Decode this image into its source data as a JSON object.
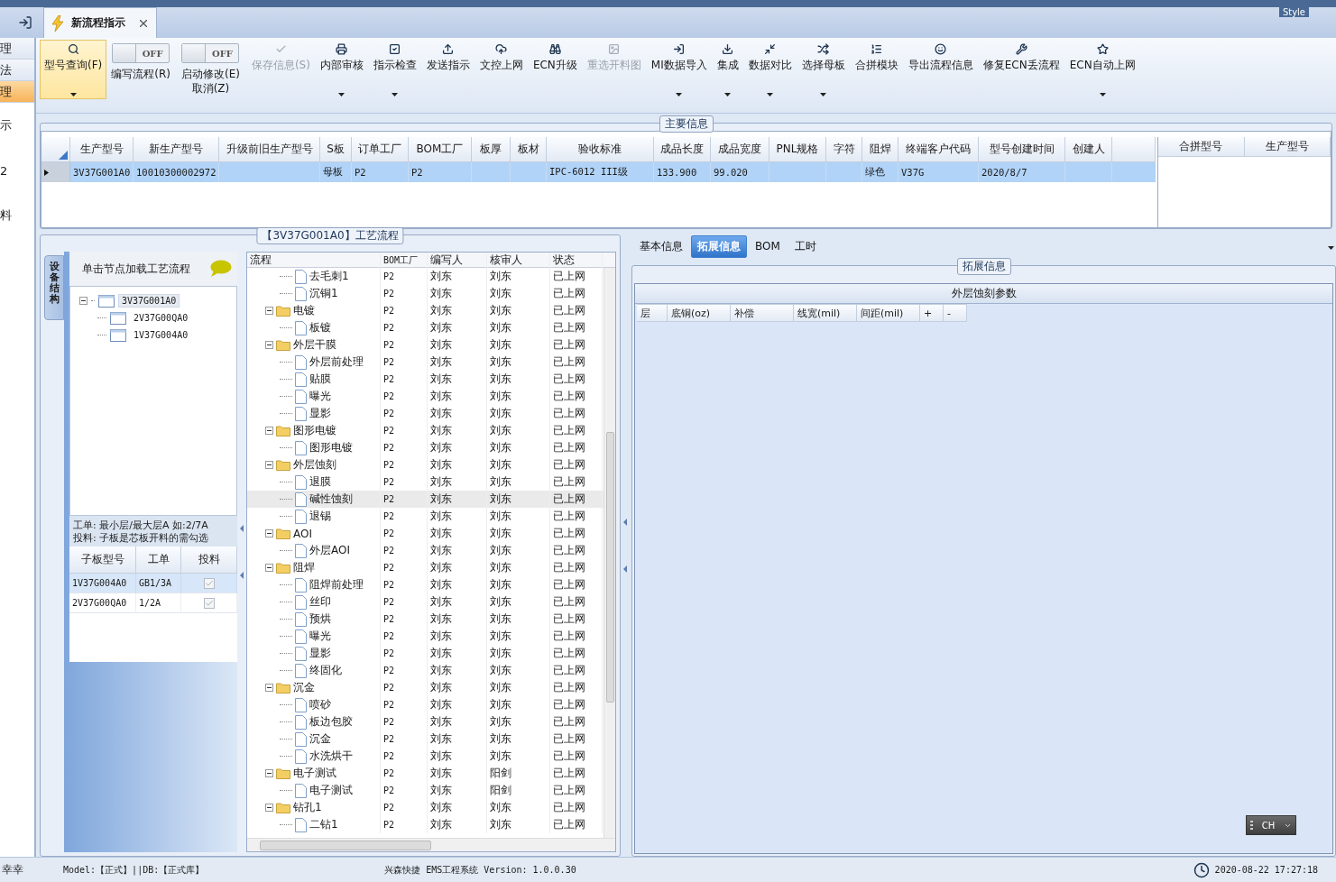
{
  "nav": {
    "items": [
      {
        "label": "理",
        "selected": false
      },
      {
        "label": "法",
        "selected": false
      },
      {
        "label": "理",
        "selected": true
      },
      {
        "label": "示",
        "selected": false
      },
      {
        "label": "2",
        "selected": false
      },
      {
        "label": "料",
        "selected": false
      }
    ]
  },
  "tabs": [
    {
      "label": "新流程指示",
      "selected": true,
      "closable": true
    }
  ],
  "style_menu": {
    "label": "Style"
  },
  "toolbar": [
    {
      "kind": "button",
      "label": "型号查询(F)",
      "selected": true,
      "disabled": false,
      "dropdown": true
    },
    {
      "kind": "toggle",
      "label": "编写流程(R)",
      "switch_text": "OFF",
      "on": false,
      "selected": false
    },
    {
      "kind": "toggle",
      "label": "启动修改(E)\n取消(Z)",
      "switch_text": "OFF",
      "on": false,
      "selected": false
    },
    {
      "kind": "button",
      "label": "保存信息(S)",
      "selected": false,
      "disabled": true,
      "dropdown": false
    },
    {
      "kind": "button",
      "label": "内部审核",
      "selected": false,
      "disabled": false,
      "dropdown": true
    },
    {
      "kind": "button",
      "label": "指示检查",
      "selected": false,
      "disabled": false,
      "dropdown": true
    },
    {
      "kind": "button",
      "label": "发送指示",
      "selected": false,
      "disabled": false,
      "dropdown": false
    },
    {
      "kind": "button",
      "label": "文控上网",
      "selected": false,
      "disabled": false,
      "dropdown": false
    },
    {
      "kind": "button",
      "label": "ECN升级",
      "selected": false,
      "disabled": false,
      "dropdown": false
    },
    {
      "kind": "button",
      "label": "重选开料图",
      "selected": false,
      "disabled": true,
      "dropdown": false
    },
    {
      "kind": "button",
      "label": "MI数据导入",
      "selected": false,
      "disabled": false,
      "dropdown": true
    },
    {
      "kind": "button",
      "label": "集成",
      "selected": false,
      "disabled": false,
      "dropdown": true
    },
    {
      "kind": "button",
      "label": "数据对比",
      "selected": false,
      "disabled": false,
      "dropdown": true
    },
    {
      "kind": "button",
      "label": "选择母板",
      "selected": false,
      "disabled": false,
      "dropdown": true
    },
    {
      "kind": "button",
      "label": "合拼模块",
      "selected": false,
      "disabled": false,
      "dropdown": false
    },
    {
      "kind": "button",
      "label": "导出流程信息",
      "selected": false,
      "disabled": false,
      "dropdown": false
    },
    {
      "kind": "button",
      "label": "修复ECN丢流程",
      "selected": false,
      "disabled": false,
      "dropdown": false
    },
    {
      "kind": "button",
      "label": "ECN自动上网",
      "selected": false,
      "disabled": false,
      "dropdown": true
    }
  ],
  "main_info": {
    "title": "主要信息",
    "columns": [
      "生产型号",
      "新生产型号",
      "升级前旧生产型号",
      "S板",
      "订单工厂",
      "BOM工厂",
      "板厚",
      "板材",
      "验收标准",
      "成品长度",
      "成品宽度",
      "PNL规格",
      "字符",
      "阻焊",
      "终端客户代码",
      "型号创建时间",
      "创建人"
    ],
    "rows": [
      {
        "selected": true,
        "cells": [
          "3V37G001A0",
          "10010300002972",
          null,
          "母板",
          "P2",
          "P2",
          null,
          null,
          "IPC-6012 III级",
          "133.900",
          "99.020",
          null,
          null,
          "绿色",
          "V37G",
          "2020/8/7",
          null
        ]
      }
    ],
    "merge_table": {
      "columns": [
        "合拼型号",
        "生产型号"
      ]
    }
  },
  "structure_panel": {
    "side_tab": "设备结构",
    "hint": "单击节点加载工艺流程",
    "tree": [
      {
        "label": "3V37G001A0",
        "expanded": true,
        "selected": true,
        "children": [
          {
            "label": "2V37G00QA0",
            "selected": false
          },
          {
            "label": "1V37G004A0",
            "selected": false
          }
        ]
      }
    ],
    "note_lines": [
      "工单: 最小层/最大层A 如:2/7A",
      "投料: 子板是芯板开料的需勾选"
    ],
    "sub_boards": {
      "columns": [
        "子板型号",
        "工单",
        "投料"
      ],
      "rows": [
        {
          "board": "1V37G004A0",
          "order": "GB1/3A",
          "feed": true,
          "selected": true
        },
        {
          "board": "2V37G00QA0",
          "order": "1/2A",
          "feed": true,
          "selected": false
        }
      ]
    }
  },
  "process": {
    "title": "【3V37G001A0】工艺流程",
    "columns": [
      "流程",
      "BOM工厂",
      "编写人",
      "核审人",
      "状态"
    ],
    "rows": [
      {
        "kind": "continued",
        "children": [
          {
            "kind": "step",
            "name": "去毛刺1",
            "bom": "P2",
            "writer": "刘东",
            "reviewer": "刘东",
            "status": "已上网",
            "selected": false
          },
          {
            "kind": "step",
            "name": "沉铜1",
            "bom": "P2",
            "writer": "刘东",
            "reviewer": "刘东",
            "status": "已上网",
            "selected": false
          }
        ]
      },
      {
        "kind": "folder",
        "name": "电镀",
        "bom": "P2",
        "writer": "刘东",
        "reviewer": "刘东",
        "status": "已上网",
        "selected": false,
        "expanded": true,
        "children": [
          {
            "kind": "step",
            "name": "板镀",
            "bom": "P2",
            "writer": "刘东",
            "reviewer": "刘东",
            "status": "已上网",
            "selected": false
          }
        ]
      },
      {
        "kind": "folder",
        "name": "外层干膜",
        "bom": "P2",
        "writer": "刘东",
        "reviewer": "刘东",
        "status": "已上网",
        "selected": false,
        "expanded": true,
        "children": [
          {
            "kind": "step",
            "name": "外层前处理",
            "bom": "P2",
            "writer": "刘东",
            "reviewer": "刘东",
            "status": "已上网",
            "selected": false
          },
          {
            "kind": "step",
            "name": "贴膜",
            "bom": "P2",
            "writer": "刘东",
            "reviewer": "刘东",
            "status": "已上网",
            "selected": false
          },
          {
            "kind": "step",
            "name": "曝光",
            "bom": "P2",
            "writer": "刘东",
            "reviewer": "刘东",
            "status": "已上网",
            "selected": false
          },
          {
            "kind": "step",
            "name": "显影",
            "bom": "P2",
            "writer": "刘东",
            "reviewer": "刘东",
            "status": "已上网",
            "selected": false
          }
        ]
      },
      {
        "kind": "folder",
        "name": "图形电镀",
        "bom": "P2",
        "writer": "刘东",
        "reviewer": "刘东",
        "status": "已上网",
        "selected": false,
        "expanded": true,
        "children": [
          {
            "kind": "step",
            "name": "图形电镀",
            "bom": "P2",
            "writer": "刘东",
            "reviewer": "刘东",
            "status": "已上网",
            "selected": false
          }
        ]
      },
      {
        "kind": "folder",
        "name": "外层蚀刻",
        "bom": "P2",
        "writer": "刘东",
        "reviewer": "刘东",
        "status": "已上网",
        "selected": false,
        "expanded": true,
        "children": [
          {
            "kind": "step",
            "name": "退膜",
            "bom": "P2",
            "writer": "刘东",
            "reviewer": "刘东",
            "status": "已上网",
            "selected": false
          },
          {
            "kind": "step",
            "name": "碱性蚀刻",
            "bom": "P2",
            "writer": "刘东",
            "reviewer": "刘东",
            "status": "已上网",
            "selected": true
          },
          {
            "kind": "step",
            "name": "退锡",
            "bom": "P2",
            "writer": "刘东",
            "reviewer": "刘东",
            "status": "已上网",
            "selected": false
          }
        ]
      },
      {
        "kind": "folder",
        "name": "AOI",
        "bom": "P2",
        "writer": "刘东",
        "reviewer": "刘东",
        "status": "已上网",
        "selected": false,
        "expanded": true,
        "children": [
          {
            "kind": "step",
            "name": "外层AOI",
            "bom": "P2",
            "writer": "刘东",
            "reviewer": "刘东",
            "status": "已上网",
            "selected": false
          }
        ]
      },
      {
        "kind": "folder",
        "name": "阻焊",
        "bom": "P2",
        "writer": "刘东",
        "reviewer": "刘东",
        "status": "已上网",
        "selected": false,
        "expanded": true,
        "children": [
          {
            "kind": "step",
            "name": "阻焊前处理",
            "bom": "P2",
            "writer": "刘东",
            "reviewer": "刘东",
            "status": "已上网",
            "selected": false
          },
          {
            "kind": "step",
            "name": "丝印",
            "bom": "P2",
            "writer": "刘东",
            "reviewer": "刘东",
            "status": "已上网",
            "selected": false
          },
          {
            "kind": "step",
            "name": "预烘",
            "bom": "P2",
            "writer": "刘东",
            "reviewer": "刘东",
            "status": "已上网",
            "selected": false
          },
          {
            "kind": "step",
            "name": "曝光",
            "bom": "P2",
            "writer": "刘东",
            "reviewer": "刘东",
            "status": "已上网",
            "selected": false
          },
          {
            "kind": "step",
            "name": "显影",
            "bom": "P2",
            "writer": "刘东",
            "reviewer": "刘东",
            "status": "已上网",
            "selected": false
          },
          {
            "kind": "step",
            "name": "终固化",
            "bom": "P2",
            "writer": "刘东",
            "reviewer": "刘东",
            "status": "已上网",
            "selected": false
          }
        ]
      },
      {
        "kind": "folder",
        "name": "沉金",
        "bom": "P2",
        "writer": "刘东",
        "reviewer": "刘东",
        "status": "已上网",
        "selected": false,
        "expanded": true,
        "children": [
          {
            "kind": "step",
            "name": "喷砂",
            "bom": "P2",
            "writer": "刘东",
            "reviewer": "刘东",
            "status": "已上网",
            "selected": false
          },
          {
            "kind": "step",
            "name": "板边包胶",
            "bom": "P2",
            "writer": "刘东",
            "reviewer": "刘东",
            "status": "已上网",
            "selected": false
          },
          {
            "kind": "step",
            "name": "沉金",
            "bom": "P2",
            "writer": "刘东",
            "reviewer": "刘东",
            "status": "已上网",
            "selected": false
          },
          {
            "kind": "step",
            "name": "水洗烘干",
            "bom": "P2",
            "writer": "刘东",
            "reviewer": "刘东",
            "status": "已上网",
            "selected": false
          }
        ]
      },
      {
        "kind": "folder",
        "name": "电子测试",
        "bom": "P2",
        "writer": "刘东",
        "reviewer": "阳剑",
        "status": "已上网",
        "selected": false,
        "expanded": true,
        "children": [
          {
            "kind": "step",
            "name": "电子测试",
            "bom": "P2",
            "writer": "刘东",
            "reviewer": "阳剑",
            "status": "已上网",
            "selected": false
          }
        ]
      },
      {
        "kind": "folder",
        "name": "钻孔1",
        "bom": "P2",
        "writer": "刘东",
        "reviewer": "刘东",
        "status": "已上网",
        "selected": false,
        "expanded": true,
        "children": [
          {
            "kind": "step",
            "name": "二钻1",
            "bom": "P2",
            "writer": "刘东",
            "reviewer": "刘东",
            "status": "已上网",
            "selected": false
          }
        ]
      }
    ]
  },
  "detail": {
    "tabs": [
      {
        "label": "基本信息",
        "selected": false
      },
      {
        "label": "拓展信息",
        "selected": true
      },
      {
        "label": "BOM",
        "selected": false
      },
      {
        "label": "工时",
        "selected": false
      }
    ],
    "group_title": "拓展信息",
    "panel_title": "外层蚀刻参数",
    "columns": [
      "层",
      "底铜(oz)",
      "补偿",
      "线宽(mil)",
      "间距(mil)",
      "+",
      "-"
    ],
    "ime": "CH"
  },
  "status_bar": {
    "user": "幸幸",
    "model": "Model:【正式】||DB:【正式库】",
    "app": "兴森快捷 EMS工程系统 Version: 1.0.0.30",
    "time": "2020-08-22 17:27:18"
  }
}
